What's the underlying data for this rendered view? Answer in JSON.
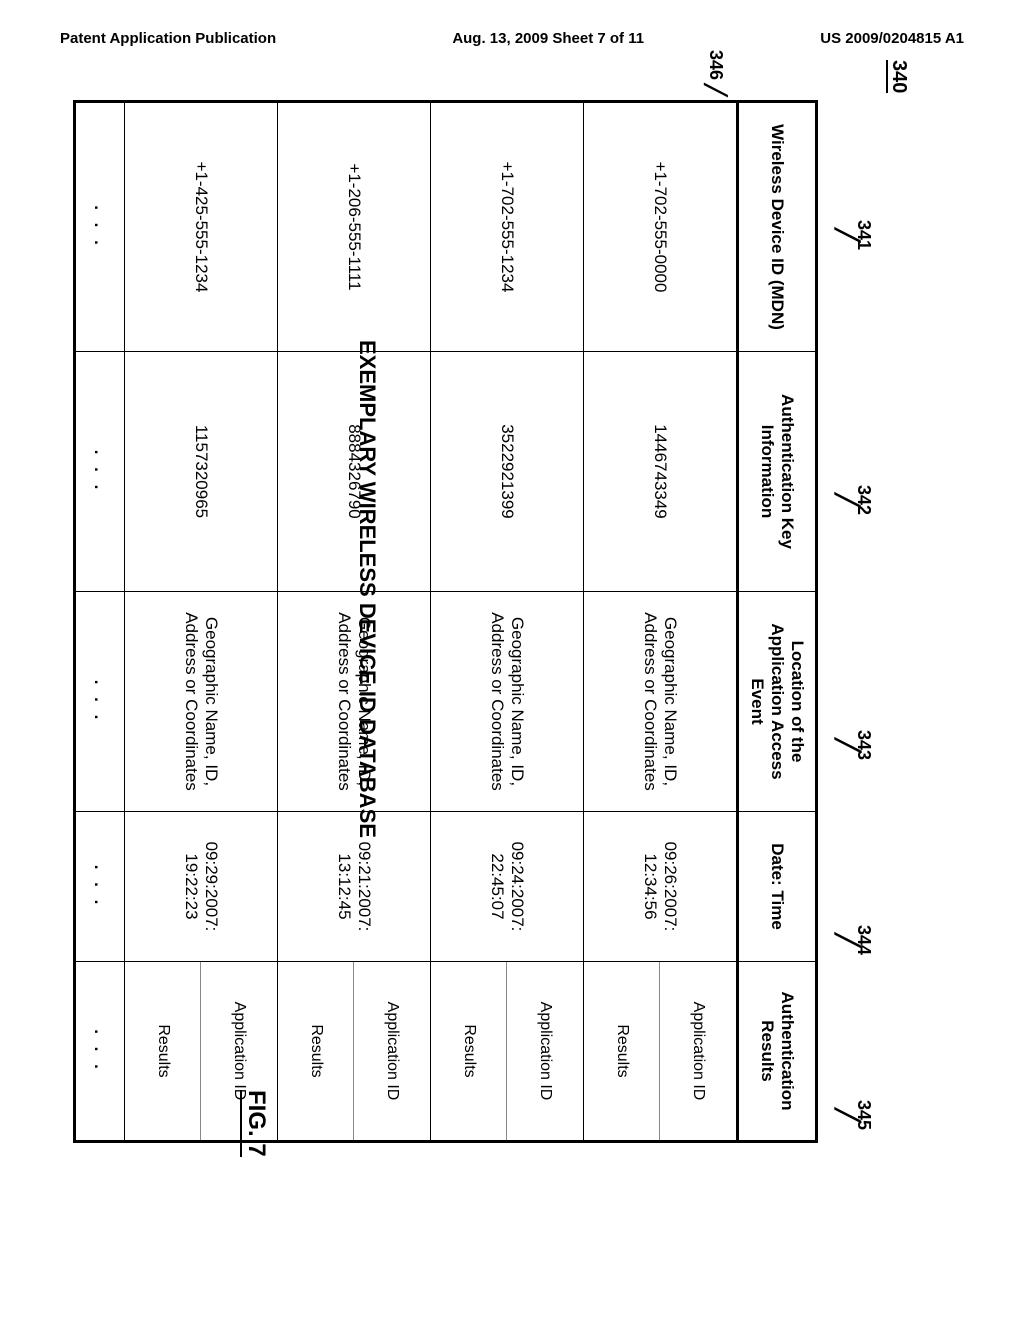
{
  "header": {
    "left": "Patent Application Publication",
    "center": "Aug. 13, 2009  Sheet 7 of 11",
    "right": "US 2009/0204815 A1"
  },
  "figure": {
    "number": "340",
    "col_labels": [
      "341",
      "342",
      "343",
      "344",
      "345"
    ],
    "row_label": "346",
    "caption": "EXEMPLARY WIRELESS DEVICE ID DATABASE",
    "fig_label": "FIG. 7"
  },
  "table": {
    "headers": {
      "mdn": "Wireless Device ID (MDN)",
      "auth_key": "Authentication Key Information",
      "location": "Location of the Application Access Event",
      "date": "Date: Time",
      "results": "Authentication Results"
    },
    "rows": [
      {
        "mdn": "+1-702-555-0000",
        "auth_key": "1446743349",
        "location": "Geographic Name, ID, Address or Coordinates",
        "date": "09:26:2007: 12:34:56",
        "res_top": "Application ID",
        "res_bottom": "Results"
      },
      {
        "mdn": "+1-702-555-1234",
        "auth_key": "3522921399",
        "location": "Geographic Name, ID, Address or Coordinates",
        "date": "09:24:2007: 22:45:07",
        "res_top": "Application ID",
        "res_bottom": "Results"
      },
      {
        "mdn": "+1-206-555-1111",
        "auth_key": "8884326790",
        "location": "Geographic Name, ID, Address or Coordinates",
        "date": "09:21:2007: 13:12:45",
        "res_top": "Application ID",
        "res_bottom": "Results"
      },
      {
        "mdn": "+1-425-555-1234",
        "auth_key": "1157320965",
        "location": "Geographic Name, ID, Address or Coordinates",
        "date": "09:29:2007: 19:22:23",
        "res_top": "Application ID",
        "res_bottom": "Results"
      }
    ],
    "ellipsis": ". . ."
  },
  "chart_data": {
    "type": "table",
    "title": "EXEMPLARY WIRELESS DEVICE ID DATABASE",
    "columns": [
      "Wireless Device ID (MDN)",
      "Authentication Key Information",
      "Location of the Application Access Event",
      "Date: Time",
      "Authentication Results"
    ],
    "rows": [
      [
        "+1-702-555-0000",
        "1446743349",
        "Geographic Name, ID, Address or Coordinates",
        "09:26:2007: 12:34:56",
        "Application ID / Results"
      ],
      [
        "+1-702-555-1234",
        "3522921399",
        "Geographic Name, ID, Address or Coordinates",
        "09:24:2007: 22:45:07",
        "Application ID / Results"
      ],
      [
        "+1-206-555-1111",
        "8884326790",
        "Geographic Name, ID, Address or Coordinates",
        "09:21:2007: 13:12:45",
        "Application ID / Results"
      ],
      [
        "+1-425-555-1234",
        "1157320965",
        "Geographic Name, ID, Address or Coordinates",
        "09:29:2007: 19:22:23",
        "Application ID / Results"
      ]
    ]
  }
}
